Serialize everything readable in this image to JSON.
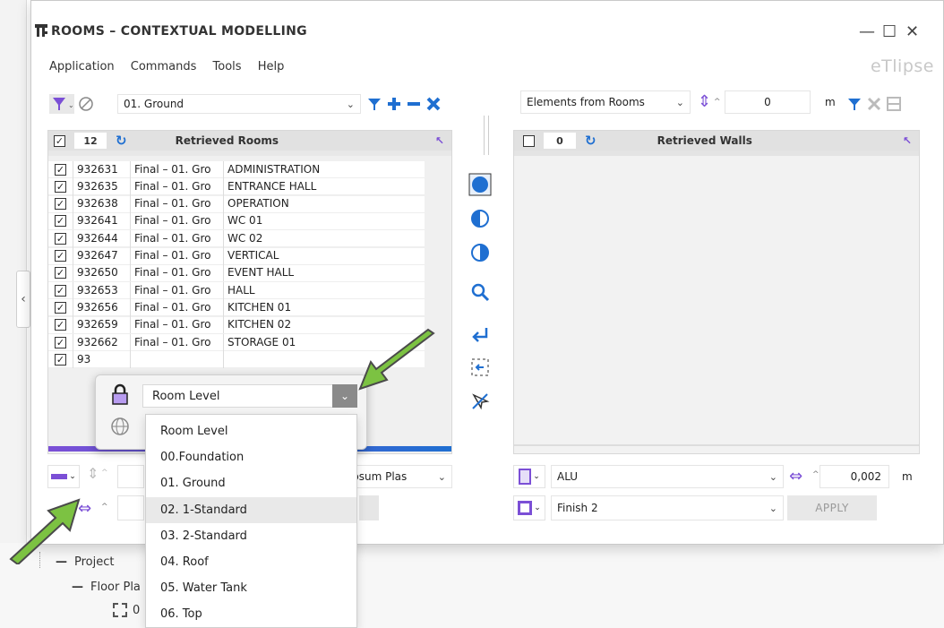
{
  "window": {
    "title": "ROOMS – CONTEXTUAL MODELLING",
    "brand": "eTlipse",
    "minimize": "—",
    "maximize": "☐",
    "close": "✕"
  },
  "menu": [
    "Application",
    "Commands",
    "Tools",
    "Help"
  ],
  "left_toolbar": {
    "level_value": "01. Ground"
  },
  "right_toolbar": {
    "source_value": "Elements from Rooms",
    "offset_value": "0",
    "offset_unit": "m"
  },
  "rooms_panel": {
    "count": "12",
    "header": "Retrieved Rooms",
    "rows": [
      {
        "id": "932631",
        "level": "Final – 01. Gro",
        "name": "ADMINISTRATION"
      },
      {
        "id": "932635",
        "level": "Final – 01. Gro",
        "name": "ENTRANCE HALL"
      },
      {
        "id": "932638",
        "level": "Final – 01. Gro",
        "name": "OPERATION"
      },
      {
        "id": "932641",
        "level": "Final – 01. Gro",
        "name": "WC 01"
      },
      {
        "id": "932644",
        "level": "Final – 01. Gro",
        "name": "WC 02"
      },
      {
        "id": "932647",
        "level": "Final – 01. Gro",
        "name": "VERTICAL"
      },
      {
        "id": "932650",
        "level": "Final – 01. Gro",
        "name": "EVENT HALL"
      },
      {
        "id": "932653",
        "level": "Final – 01. Gro",
        "name": "HALL"
      },
      {
        "id": "932656",
        "level": "Final – 01. Gro",
        "name": "KITCHEN 01"
      },
      {
        "id": "932659",
        "level": "Final – 01. Gro",
        "name": "KITCHEN 02"
      },
      {
        "id": "932662",
        "level": "Final – 01. Gro",
        "name": "STORAGE 01"
      },
      {
        "id": "93",
        "level": "",
        "name": ""
      }
    ]
  },
  "walls_panel": {
    "count": "0",
    "header": "Retrieved Walls"
  },
  "bottom_left": {
    "material_partial": "ypsum Plas"
  },
  "bottom_right": {
    "type_value": "ALU",
    "thickness_value": "0,002",
    "thickness_unit": "m",
    "finish_value": "Finish 2",
    "apply_label": "APPLY"
  },
  "popup": {
    "selected": "Room Level",
    "options": [
      "Room Level",
      "00.Foundation",
      "01. Ground",
      "02. 1-Standard",
      "03. 2-Standard",
      "04. Roof",
      "05. Water Tank",
      "06. Top"
    ],
    "highlighted_index": 3
  },
  "project_tree": {
    "root": "Project",
    "child": "Floor Pla",
    "leaf1": "0"
  },
  "colors": {
    "accent_blue": "#1f6fd1",
    "accent_purple": "#7b4fd6",
    "arrow_green": "#7cc242"
  }
}
